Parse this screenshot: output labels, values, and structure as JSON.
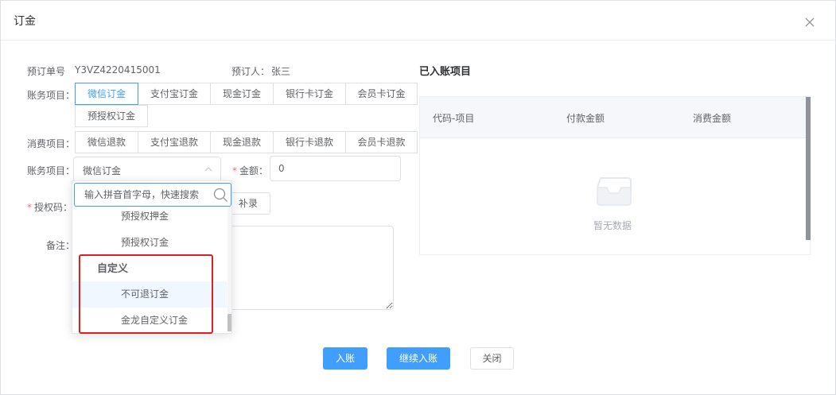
{
  "dialog": {
    "title": "订金"
  },
  "info": {
    "order_label": "预订单号",
    "order_no": "Y3VZ4220415001",
    "booker_label": "预订人：",
    "booker_name": "张三"
  },
  "account_items": {
    "label": "账务项目：",
    "tabs": [
      "微信订金",
      "支付宝订金",
      "现金订金",
      "银行卡订金",
      "会员卡订金",
      "预授权订金"
    ],
    "active_index": 0
  },
  "consume_items": {
    "label": "消费项目：",
    "tabs": [
      "微信退款",
      "支付宝退款",
      "现金退款",
      "银行卡退款",
      "会员卡退款"
    ]
  },
  "form": {
    "account_label": "账务项目：",
    "account_selected": "微信订金",
    "amount_label": "金额：",
    "amount_value": "0",
    "auth_label": "授权码：",
    "supplement_button": "补录",
    "remark_label": "备注："
  },
  "dropdown": {
    "search_placeholder": "输入拼音首字母，快速搜索",
    "items": [
      "预授权押金",
      "预授权订金"
    ],
    "group_label": "自定义",
    "group_items": [
      "不可退订金",
      "金龙自定义订金"
    ]
  },
  "posted": {
    "title": "已入账项目",
    "columns": [
      "代码-项目",
      "付款金额",
      "消费金额"
    ],
    "empty_text": "暂无数据"
  },
  "footer": {
    "post_button": "入账",
    "continue_button": "继续入账",
    "close_button": "关闭"
  },
  "colors": {
    "primary": "#409eff",
    "required": "#f56c6c",
    "highlight": "#e02020"
  }
}
